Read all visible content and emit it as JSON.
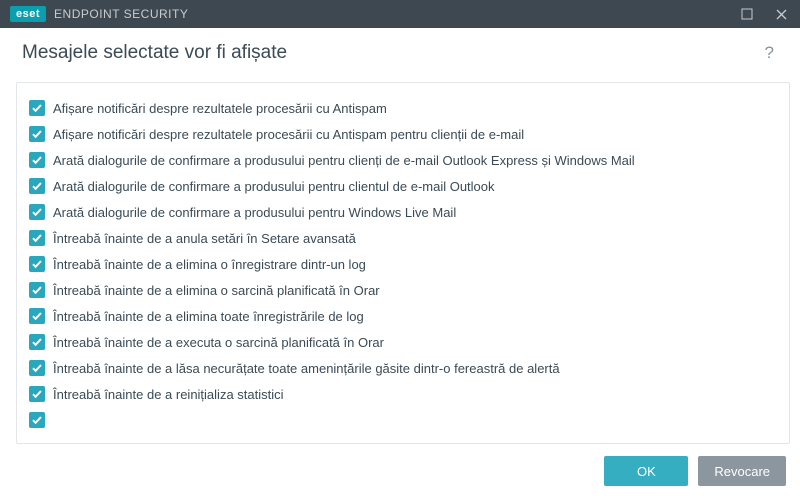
{
  "brand": "eset",
  "app_title": "ENDPOINT SECURITY",
  "page_title": "Mesajele selectate vor fi afișate",
  "items": [
    {
      "label": "Afișare notificări despre rezultatele procesării cu Antispam",
      "checked": true
    },
    {
      "label": "Afișare notificări despre rezultatele procesării cu Antispam pentru clienții de e-mail",
      "checked": true
    },
    {
      "label": "Arată dialogurile de confirmare a produsului pentru clienți de e-mail Outlook Express și Windows Mail",
      "checked": true
    },
    {
      "label": "Arată dialogurile de confirmare a produsului pentru clientul de e-mail Outlook",
      "checked": true
    },
    {
      "label": "Arată dialogurile de confirmare a produsului pentru Windows Live Mail",
      "checked": true
    },
    {
      "label": "Întreabă înainte de a anula setări în Setare avansată",
      "checked": true
    },
    {
      "label": "Întreabă înainte de a elimina o înregistrare dintr-un log",
      "checked": true
    },
    {
      "label": "Întreabă înainte de a elimina o sarcină planificată în Orar",
      "checked": true
    },
    {
      "label": "Întreabă înainte de a elimina toate înregistrările de log",
      "checked": true
    },
    {
      "label": "Întreabă înainte de a executa o sarcină planificată în Orar",
      "checked": true
    },
    {
      "label": "Întreabă înainte de a lăsa necurățate toate amenințările găsite dintr-o fereastră de alertă",
      "checked": true
    },
    {
      "label": "Întreabă înainte de a reinițializa statistici",
      "checked": true
    },
    {
      "label": " ",
      "checked": true
    }
  ],
  "buttons": {
    "ok": "OK",
    "cancel": "Revocare"
  }
}
